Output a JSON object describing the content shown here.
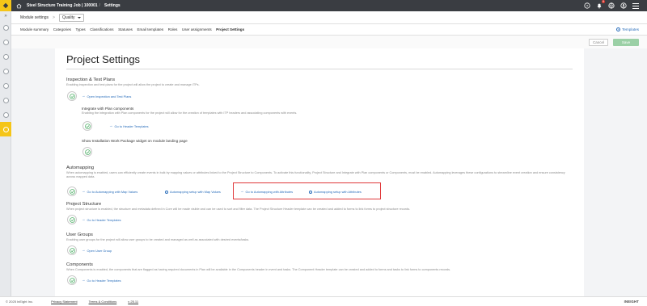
{
  "topbar": {
    "job_title": "Steel Structure Training Job | 100001",
    "separator": "/",
    "section": "Settings",
    "notifications_badge": "9"
  },
  "subheader": {
    "module_settings_label": "Module settings",
    "breadcrumb_separator": ">",
    "module_selected": "Quality"
  },
  "tabs": [
    {
      "label": "Module summary"
    },
    {
      "label": "Categories"
    },
    {
      "label": "Types"
    },
    {
      "label": "Classifications"
    },
    {
      "label": "Statuses"
    },
    {
      "label": "Email templates"
    },
    {
      "label": "Roles"
    },
    {
      "label": "User assignments"
    },
    {
      "label": "Project Settings",
      "active": true
    }
  ],
  "templates_link": "Templates",
  "actions": {
    "cancel_label": "Cancel",
    "save_label": "Save"
  },
  "page": {
    "title": "Project Settings",
    "inspection": {
      "title": "Inspection & Test Plans",
      "desc": "Enabling inspection and test plans for the project will allow the project to create and manage ITPs.",
      "link": "Open Inspection and Test Plans",
      "plan_title": "Integrate with Plan components",
      "plan_desc": "Enabling the integration with Plan components for the project will allow for the creation of templates with ITP headers and associating components with events.",
      "plan_link": "Go to Header Templates",
      "iwp_title": "Show Installation Work Package widget on module landing page"
    },
    "automapping": {
      "title": "Automapping",
      "desc": "When automapping is enabled, users can efficiently create events in bulk by mapping values or attributes linked to the Project Structure to Components. To activate this functionality, Project Structure and Integrate with Plan components or Components, must be enabled. Automapping leverages these configurations to streamline event creation and ensure consistency across mapped data.",
      "link1": "Go to Automapping with Map Values",
      "link2": "Automapping setup with Map Values",
      "link3": "Go to Automapping with Attributes",
      "link4": "Automapping setup with Attributes"
    },
    "project_structure": {
      "title": "Project Structure",
      "desc": "When project structure is enabled, the structure and metadata defined in Core will be made visible and can be used to sort and filter data. The Project Structure Header template can be created and added to forms to link forms to project structure records.",
      "link": "Go to Header Templates"
    },
    "user_groups": {
      "title": "User Groups",
      "desc": "Enabling user groups for the project will allow user groups to be created and managed as well as associated with desired events/tasks.",
      "link": "Open User Group"
    },
    "components": {
      "title": "Components",
      "desc": "When Components is enabled, the components that are flagged as having required documents in Plan will be available in the Components header in event and tasks. The Component Header template can be created and added to forms and tasks to link forms to components records.",
      "link": "Go to Header Templates"
    }
  },
  "footer": {
    "copyright": "© 2025 InEight Inc.",
    "privacy": "Privacy Statement",
    "terms": "Terms & Conditions",
    "version": "v 25.11",
    "brand": "INEIGHT"
  },
  "colors": {
    "accent": "#f5c518",
    "link": "#2a6ebb",
    "toggle_on": "#3aa655",
    "highlight": "#e0383a"
  }
}
